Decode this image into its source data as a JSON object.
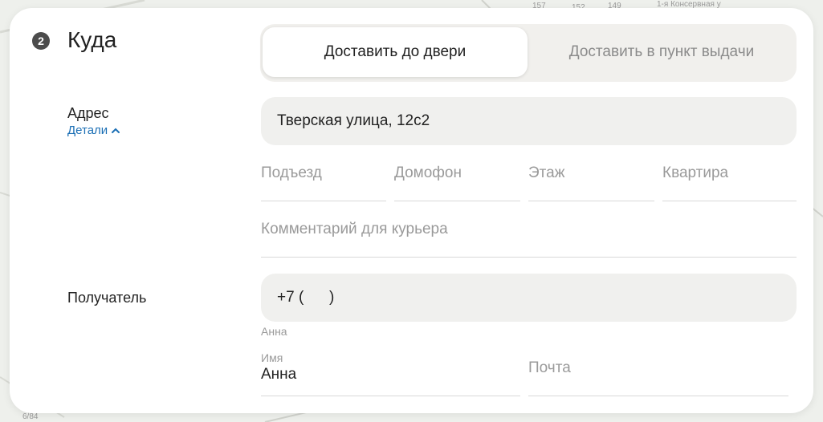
{
  "step": {
    "number": "2",
    "title": "Куда"
  },
  "delivery_mode": {
    "options": [
      "Доставить до двери",
      "Доставить в пункт выдачи"
    ],
    "selected": "Доставить до двери"
  },
  "address": {
    "label": "Адрес",
    "details_link": "Детали",
    "value": "Тверская улица, 12с2",
    "fields": {
      "entrance": "Подъезд",
      "intercom": "Домофон",
      "floor": "Этаж",
      "apartment": "Квартира"
    },
    "courier_comment_placeholder": "Комментарий для курьера"
  },
  "recipient": {
    "label": "Получатель",
    "phone_value": "+7 (      )",
    "phone_hint": "Анна",
    "name_label": "Имя",
    "name_value": "Анна",
    "email_placeholder": "Почта"
  },
  "map_labels": [
    "1-я Консервная у",
    "157",
    "152",
    "149",
    "6/84"
  ],
  "colors": {
    "accent_link": "#1b6fb5",
    "card_bg": "#ffffff",
    "field_bg": "#f0f0ee"
  }
}
